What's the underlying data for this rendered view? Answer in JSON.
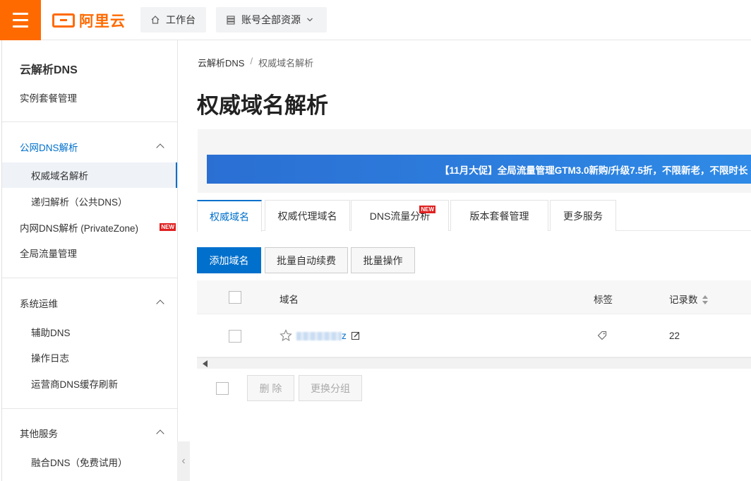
{
  "topbar": {
    "logo_text": "阿里云",
    "workbench_label": "工作台",
    "resources_label": "账号全部资源",
    "brand_color": "#ff6a00"
  },
  "sidebar": {
    "title": "云解析DNS",
    "items": [
      {
        "label": "实例套餐管理"
      },
      {
        "label": "公网DNS解析"
      },
      {
        "label": "权威域名解析"
      },
      {
        "label": "递归解析（公共DNS）"
      },
      {
        "label": "内网DNS解析 (PrivateZone)"
      },
      {
        "label": "全局流量管理"
      },
      {
        "label": "系统运维"
      },
      {
        "label": "辅助DNS"
      },
      {
        "label": "操作日志"
      },
      {
        "label": "运营商DNS缓存刷新"
      },
      {
        "label": "其他服务"
      },
      {
        "label": "融合DNS（免费试用）"
      }
    ],
    "new_badge": "NEW"
  },
  "breadcrumb": {
    "root": "云解析DNS",
    "sep": "/",
    "current": "权威域名解析"
  },
  "page_title": "权威域名解析",
  "banner": {
    "text": "【11月大促】全局流量管理GTM3.0新购/升级7.5折，不限新老，不限时长"
  },
  "tabs": [
    {
      "label": "权威域名"
    },
    {
      "label": "权威代理域名"
    },
    {
      "label": "DNS流量分析",
      "badge": "NEW"
    },
    {
      "label": "版本套餐管理"
    },
    {
      "label": "更多服务"
    }
  ],
  "actions": {
    "add": "添加域名",
    "renew": "批量自动续费",
    "batch": "批量操作"
  },
  "table": {
    "columns": {
      "domain": "域名",
      "tag": "标签",
      "records": "记录数"
    },
    "rows": [
      {
        "domain_suffix": "z",
        "records": "22"
      }
    ]
  },
  "footer_actions": {
    "delete": "删 除",
    "change_group": "更换分组"
  },
  "accent_color": "#0070cc"
}
